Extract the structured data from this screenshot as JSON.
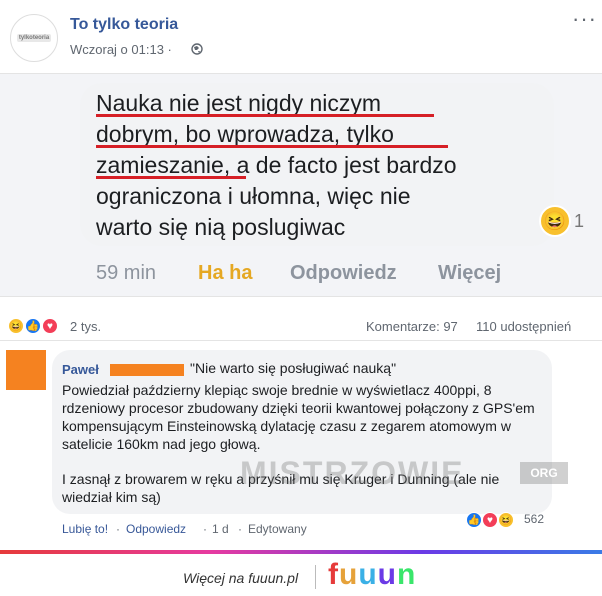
{
  "header": {
    "avatar_text": "tylkoteoria",
    "page_name": "To tylko teoria",
    "post_time": "Wczoraj o 01:13 ·",
    "more": "···"
  },
  "shot1": {
    "quote_line1": "Nauka nie jest nigdy niczym",
    "quote_line2": "dobrym, bo wprowadza, tylko",
    "quote_line3a": "zamieszanie",
    "quote_line3b": ", a de facto jest bardzo",
    "quote_line4": "ograniczona i ułomna, więc nie",
    "quote_line5": "warto się nią poslugiwac",
    "emoji": "😆",
    "emoji_count": "1",
    "time": "59 min",
    "haha": "Ha ha",
    "reply": "Odpowiedz",
    "more": "Więcej",
    "accent": "#d61f26"
  },
  "stats": {
    "reactions": "2 tys.",
    "comments": "Komentarze: 97",
    "shares": "110 udostępnień"
  },
  "comment": {
    "author": "Paweł",
    "title": "\"Nie warto się posługiwać nauką\"",
    "body": "Powiedział październy klepiąc swoje brednie w wyświetlacz 400ppi, 8 rdzeniowy procesor zbudowany dzięki teorii kwantowej połączony z GPS'em kompensującym Einsteinowską dylatację czasu z zegarem atomowym w satelicie 160km nad jego głową.",
    "body2": "I zasnął z browarem w ręku a przyśnił mu się Kruger i Dunning (ale nie wiedział kim są)",
    "like": "Lubię to!",
    "reply": "Odpowiedz",
    "age": "1 d",
    "edited": "Edytowany",
    "reaction_count": "562"
  },
  "watermark": {
    "text": "MISTRZOWIE",
    "suffix": "ORG"
  },
  "footer": {
    "text": "Więcej na fuuun.pl",
    "logo": "fuuun"
  }
}
